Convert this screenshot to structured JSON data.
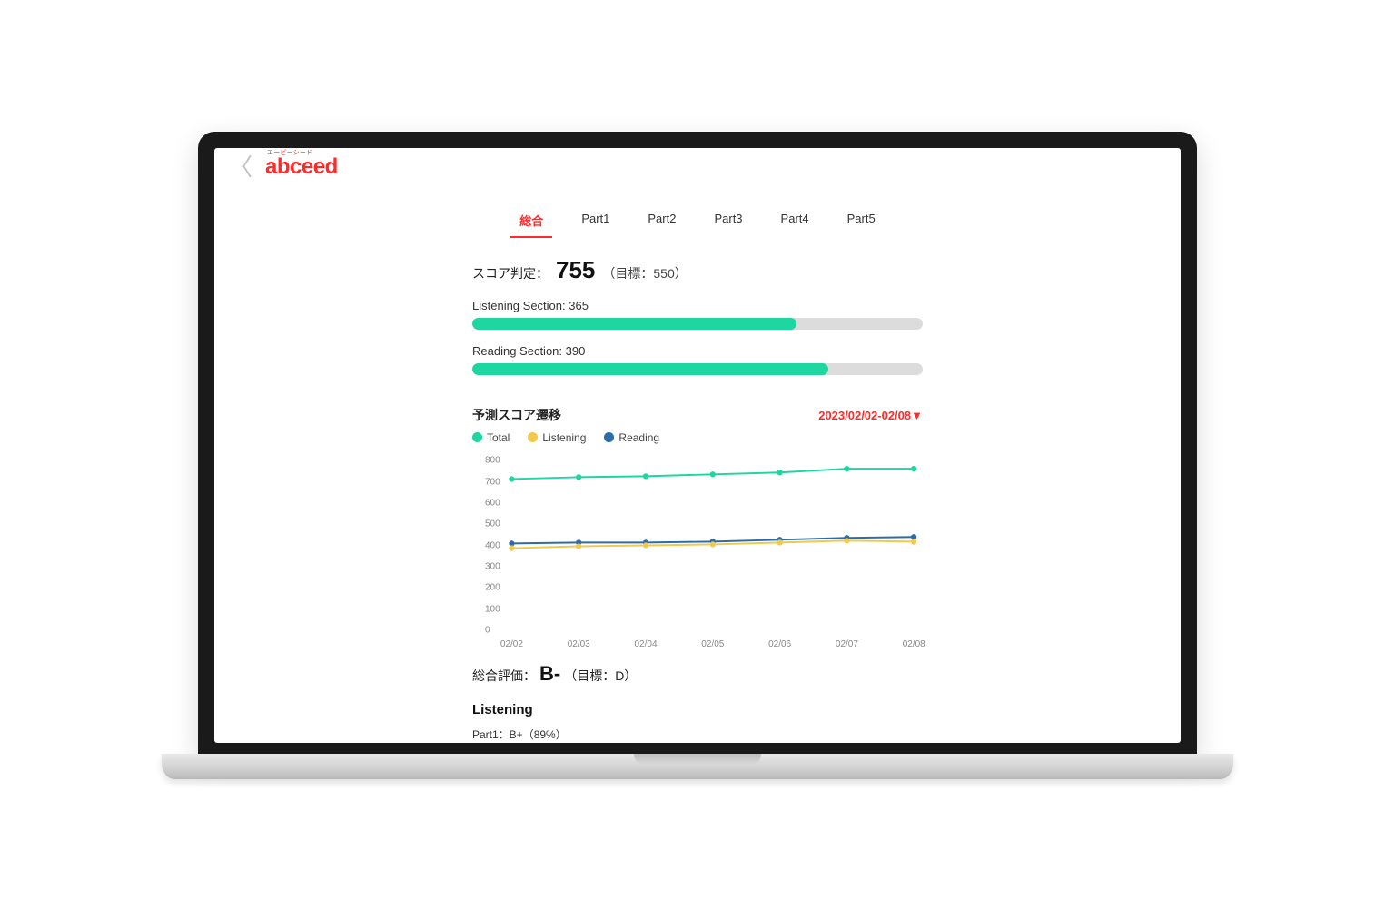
{
  "header": {
    "brand": "abceed",
    "brand_ruby": "エービーシード"
  },
  "tabs": [
    {
      "label": "総合",
      "active": true
    },
    {
      "label": "Part1",
      "active": false
    },
    {
      "label": "Part2",
      "active": false
    },
    {
      "label": "Part3",
      "active": false
    },
    {
      "label": "Part4",
      "active": false
    },
    {
      "label": "Part5",
      "active": false
    }
  ],
  "score": {
    "label": "スコア判定：",
    "value": "755",
    "target": "（目標：550）"
  },
  "sections": [
    {
      "label": "Listening Section: 365",
      "percent": 72
    },
    {
      "label": "Reading Section: 390",
      "percent": 79
    }
  ],
  "chart": {
    "title": "予測スコア遷移",
    "date_range": "2023/02/02-02/08▼",
    "legend": [
      {
        "name": "Total",
        "color": "#1dd6a0"
      },
      {
        "name": "Listening",
        "color": "#f2c94c"
      },
      {
        "name": "Reading",
        "color": "#2d6da5"
      }
    ]
  },
  "chart_data": {
    "type": "line",
    "categories": [
      "02/02",
      "02/03",
      "02/04",
      "02/05",
      "02/06",
      "02/07",
      "02/08"
    ],
    "series": [
      {
        "name": "Total",
        "color": "#1dd6a0",
        "values": [
          700,
          710,
          715,
          725,
          735,
          755,
          755
        ]
      },
      {
        "name": "Reading",
        "color": "#2d6da5",
        "values": [
          355,
          360,
          360,
          365,
          375,
          385,
          390
        ]
      },
      {
        "name": "Listening",
        "color": "#f2c94c",
        "values": [
          330,
          340,
          345,
          350,
          360,
          370,
          365
        ]
      }
    ],
    "ylim": [
      0,
      800
    ],
    "yticks": [
      0,
      100,
      200,
      300,
      400,
      500,
      600,
      700,
      800
    ],
    "xlabel": "",
    "ylabel": "",
    "title": "予測スコア遷移"
  },
  "rating": {
    "label": "総合評価：",
    "value": "B-",
    "target": "（目標：D）"
  },
  "subsection": {
    "title": "Listening",
    "part_line": "Part1：B+（89%）"
  }
}
